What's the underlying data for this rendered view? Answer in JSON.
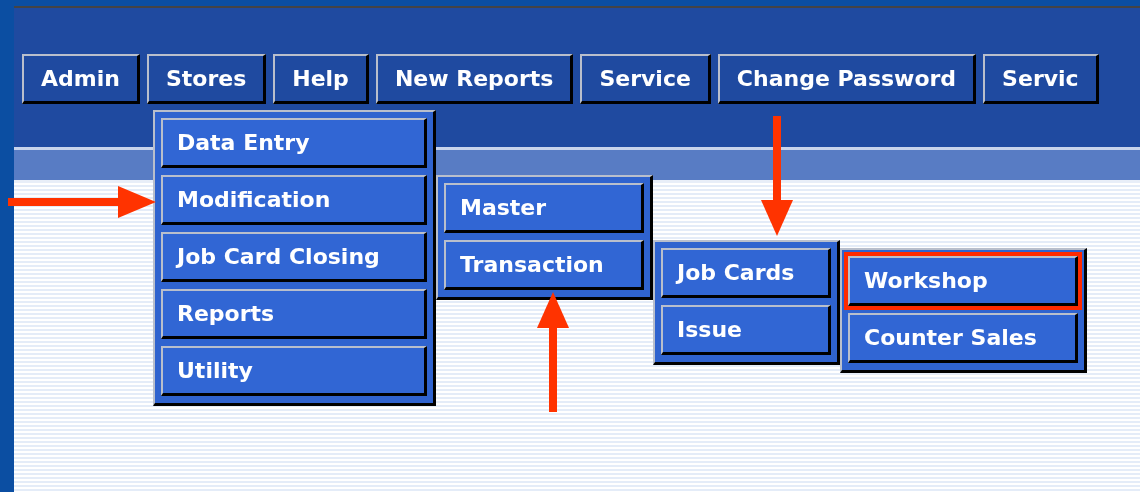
{
  "menubar": [
    {
      "label": "Admin"
    },
    {
      "label": "Stores",
      "children": [
        {
          "label": "Data Entry"
        },
        {
          "label": "Modification",
          "children": [
            {
              "label": "Master"
            },
            {
              "label": "Transaction",
              "children": [
                {
                  "label": "Job Cards",
                  "children": [
                    {
                      "label": "Workshop",
                      "highlighted": true
                    },
                    {
                      "label": "Counter Sales",
                      "highlighted": false
                    }
                  ]
                },
                {
                  "label": "Issue"
                }
              ]
            }
          ]
        },
        {
          "label": "Job Card Closing"
        },
        {
          "label": "Reports"
        },
        {
          "label": "Utility"
        }
      ]
    },
    {
      "label": "Help"
    },
    {
      "label": "New Reports"
    },
    {
      "label": "Service"
    },
    {
      "label": "Change Password"
    },
    {
      "label": "Servic"
    }
  ],
  "annotations": [
    {
      "kind": "arrow-right"
    },
    {
      "kind": "arrow-up"
    },
    {
      "kind": "arrow-down"
    }
  ]
}
